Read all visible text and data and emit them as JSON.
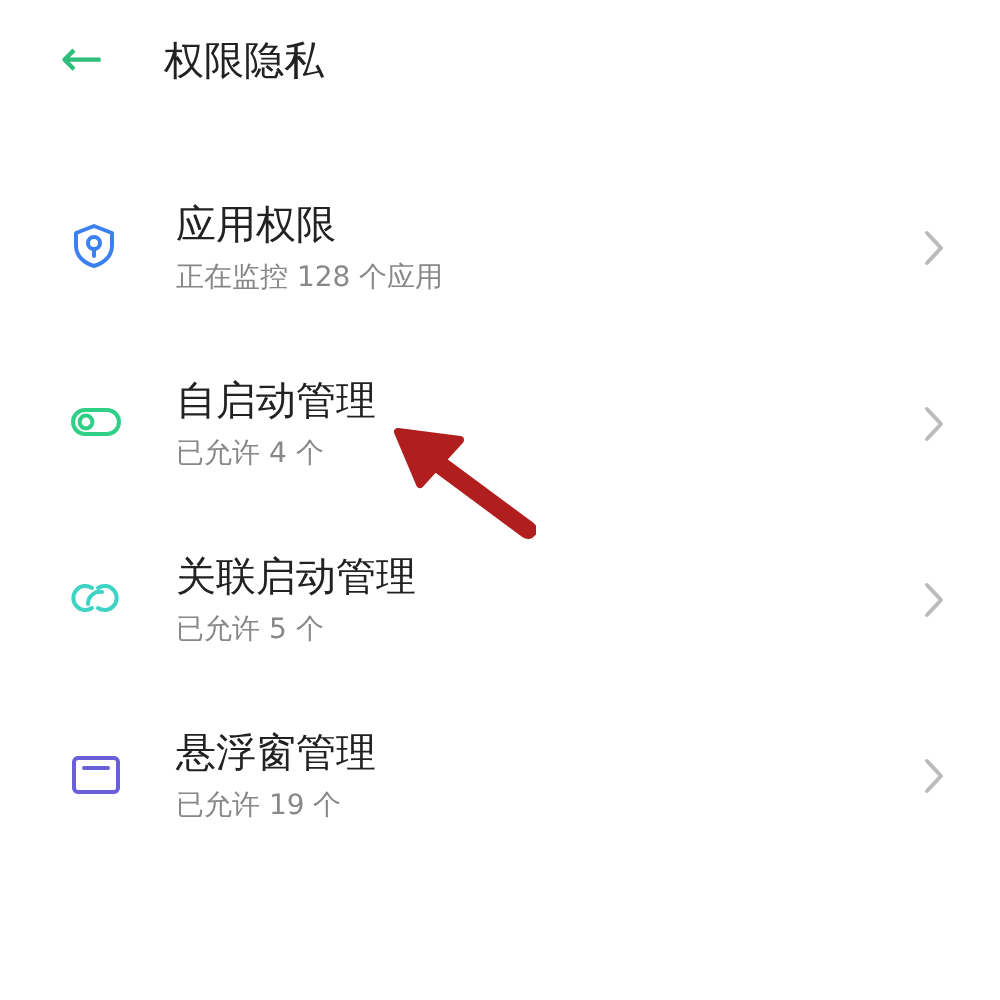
{
  "header": {
    "back_icon": "←",
    "title": "权限隐私"
  },
  "items": [
    {
      "kind": "shield",
      "color": "#3b7ff0",
      "title": "应用权限",
      "subtitle": "正在监控 128 个应用"
    },
    {
      "kind": "toggle",
      "color": "#2fcf86",
      "title": "自启动管理",
      "subtitle": "已允许 4 个"
    },
    {
      "kind": "rings",
      "color": "#3fd3c3",
      "title": "关联启动管理",
      "subtitle": "已允许 5 个"
    },
    {
      "kind": "window",
      "color": "#6a5fd8",
      "title": "悬浮窗管理",
      "subtitle": "已允许 19 个"
    }
  ]
}
